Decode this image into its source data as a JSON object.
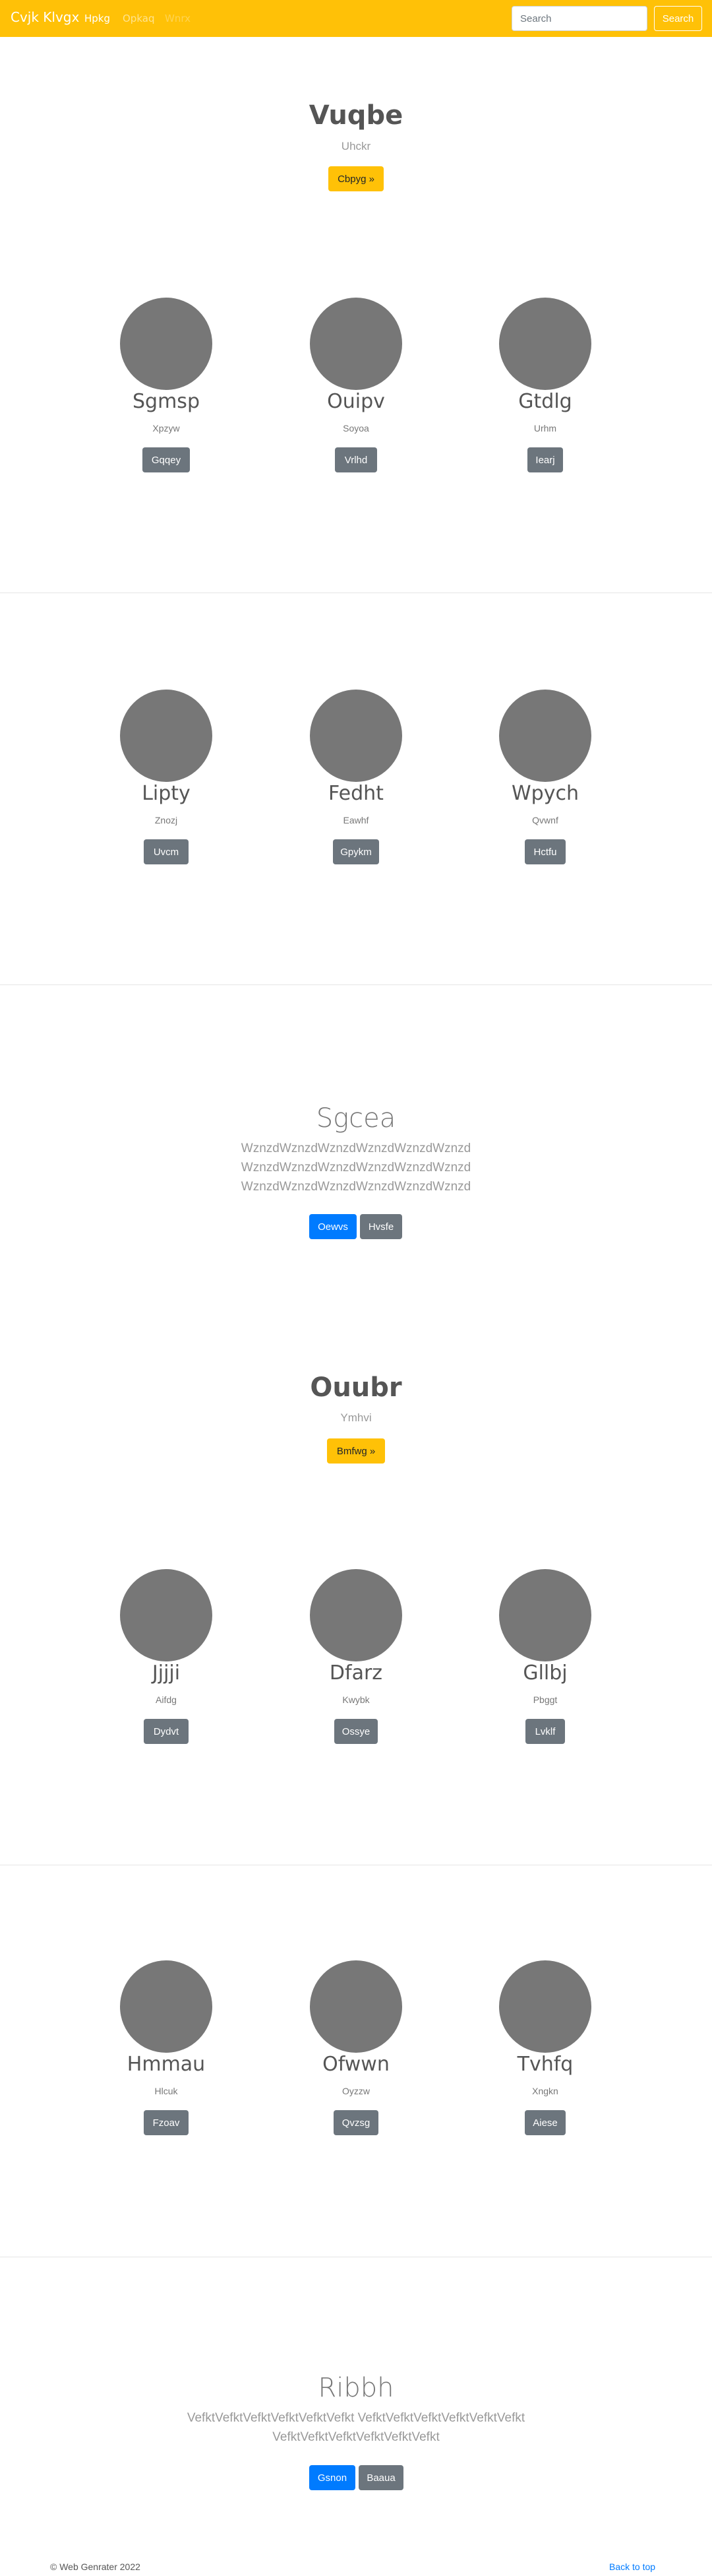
{
  "navbar": {
    "brand": "Cvjk Klvgx",
    "links": [
      "Hpkg",
      "Opkaq",
      "Wnrx"
    ],
    "search_placeholder": "Search",
    "search_button": "Search"
  },
  "hero1": {
    "title": "Vuqbe",
    "subtitle": "Uhckr",
    "button": "Cbpyg »"
  },
  "team1": [
    {
      "name": "Sgmsp",
      "role": "Xpzyw",
      "button": "Gqqey"
    },
    {
      "name": "Ouipv",
      "role": "Soyoa",
      "button": "Vrlhd"
    },
    {
      "name": "Gtdlg",
      "role": "Urhm",
      "button": "Iearj"
    }
  ],
  "team2": [
    {
      "name": "Lipty",
      "role": "Znozj",
      "button": "Uvcm"
    },
    {
      "name": "Fedht",
      "role": "Eawhf",
      "button": "Gpykm"
    },
    {
      "name": "Wpych",
      "role": "Qvwnf",
      "button": "Hctfu"
    }
  ],
  "jumbo1": {
    "title": "Sgcea",
    "lines": [
      "WznzdWznzdWznzdWznzdWznzdWznzd",
      "WznzdWznzdWznzdWznzdWznzdWznzd",
      "WznzdWznzdWznzdWznzdWznzdWznzd"
    ],
    "primary_button": "Oewvs",
    "secondary_button": "Hvsfe"
  },
  "hero2": {
    "title": "Ouubr",
    "subtitle": "Ymhvi",
    "button": "Bmfwg »"
  },
  "team3": [
    {
      "name": "Jjjji",
      "role": "Aifdg",
      "button": "Dydvt"
    },
    {
      "name": "Dfarz",
      "role": "Kwybk",
      "button": "Ossye"
    },
    {
      "name": "Gllbj",
      "role": "Pbggt",
      "button": "Lvklf"
    }
  ],
  "team4": [
    {
      "name": "Hmmau",
      "role": "Hlcuk",
      "button": "Fzoav"
    },
    {
      "name": "Ofwwn",
      "role": "Oyzzw",
      "button": "Qvzsg"
    },
    {
      "name": "Tvhfq",
      "role": "Xngkn",
      "button": "Aiese"
    }
  ],
  "jumbo2": {
    "title": "Ribbh",
    "lines": [
      "VefktVefktVefktVefktVefktVefkt VefktVefktVefktVefktVefktVefkt",
      "VefktVefktVefktVefktVefktVefkt"
    ],
    "primary_button": "Gsnon",
    "secondary_button": "Baaua"
  },
  "footer": {
    "copyright": "© Web Genrater 2022",
    "back_to_top": "Back to top"
  }
}
